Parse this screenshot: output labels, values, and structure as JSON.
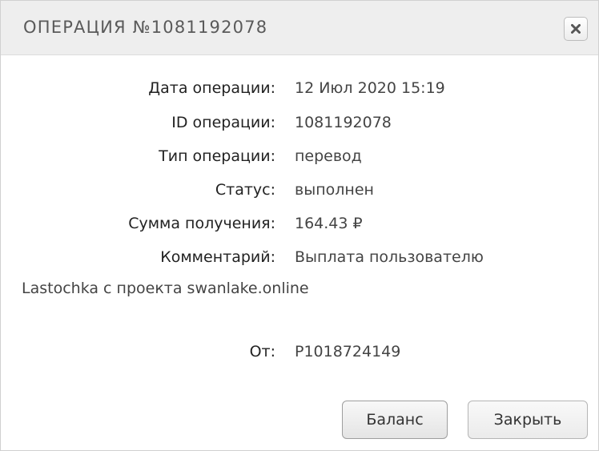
{
  "dialog": {
    "title": "ОПЕРАЦИЯ №1081192078",
    "close_icon": "close-x-icon"
  },
  "details": {
    "date_label": "Дата операции:",
    "date_value": "12 Июл 2020 15:19",
    "id_label": "ID операции:",
    "id_value": "1081192078",
    "type_label": "Тип операции:",
    "type_value": "перевод",
    "status_label": "Статус:",
    "status_value": "выполнен",
    "amount_label": "Сумма получения:",
    "amount_value": "164.43 ₽",
    "comment_label": "Комментарий:",
    "comment_value_line1": "Выплата пользователю",
    "comment_value_line2": "Lastochka с проекта swanlake.online",
    "from_label": "От:",
    "from_value": "P1018724149"
  },
  "buttons": {
    "balance_label": "Баланс",
    "close_label": "Закрыть"
  }
}
